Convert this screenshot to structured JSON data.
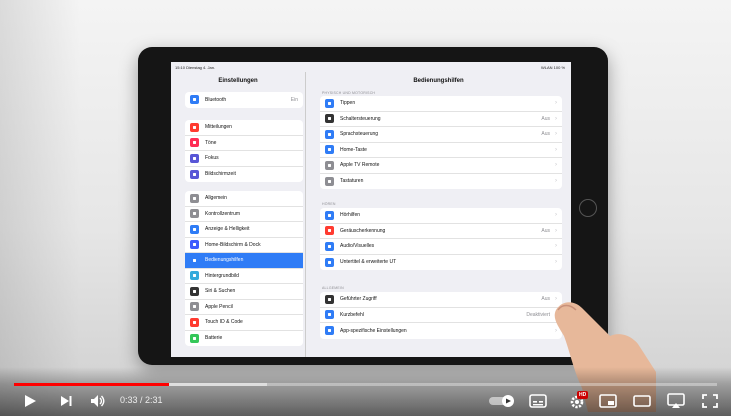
{
  "statusbar": {
    "time": "15:10  Dienstag 4. Jan.",
    "right": "WLAN 100 %"
  },
  "sidebar": {
    "title": "Einstellungen",
    "group1": [
      {
        "label": "Bluetooth",
        "value": "Ein",
        "icon": "bluetooth-icon",
        "color": "#2f7cf6"
      }
    ],
    "group2": [
      {
        "label": "Mitteilungen",
        "icon": "notifications-icon",
        "color": "#ff3b30"
      },
      {
        "label": "Töne",
        "icon": "sound-icon",
        "color": "#ff2d55"
      },
      {
        "label": "Fokus",
        "icon": "moon-icon",
        "color": "#5856d6"
      },
      {
        "label": "Bildschirmzeit",
        "icon": "hourglass-icon",
        "color": "#5856d6"
      }
    ],
    "group3": [
      {
        "label": "Allgemein",
        "icon": "gear-icon",
        "color": "#8e8e93"
      },
      {
        "label": "Kontrollzentrum",
        "icon": "control-center-icon",
        "color": "#8e8e93"
      },
      {
        "label": "Anzeige & Helligkeit",
        "icon": "display-icon",
        "color": "#2f7cf6"
      },
      {
        "label": "Home-Bildschirm & Dock",
        "icon": "home-screen-icon",
        "color": "#3d5afe"
      },
      {
        "label": "Bedienungshilfen",
        "icon": "accessibility-icon",
        "color": "#2f7cf6",
        "selected": true
      },
      {
        "label": "Hintergrundbild",
        "icon": "wallpaper-icon",
        "color": "#34aadc"
      },
      {
        "label": "Siri & Suchen",
        "icon": "siri-icon",
        "color": "#333333"
      },
      {
        "label": "Apple Pencil",
        "icon": "pencil-icon",
        "color": "#8e8e93"
      },
      {
        "label": "Touch ID & Code",
        "icon": "fingerprint-icon",
        "color": "#ff3b30"
      },
      {
        "label": "Batterie",
        "icon": "battery-icon",
        "color": "#34c759"
      }
    ]
  },
  "detail": {
    "title": "Bedienungshilfen",
    "sec1_header": "PHYSISCH UND MOTORISCH",
    "group1": [
      {
        "label": "Tippen",
        "icon": "hand-icon",
        "color": "#2f7cf6"
      },
      {
        "label": "Schaltersteuerung",
        "icon": "switch-icon",
        "color": "#333333",
        "value": "Aus"
      },
      {
        "label": "Sprachsteuerung",
        "icon": "voice-icon",
        "color": "#2f7cf6",
        "value": "Aus"
      },
      {
        "label": "Home-Taste",
        "icon": "home-button-icon",
        "color": "#2f7cf6"
      },
      {
        "label": "Apple TV Remote",
        "icon": "remote-icon",
        "color": "#8e8e93"
      },
      {
        "label": "Tastaturen",
        "icon": "keyboard-icon",
        "color": "#8e8e93"
      }
    ],
    "sec2_header": "HÖREN",
    "group2": [
      {
        "label": "Hörhilfen",
        "icon": "ear-icon",
        "color": "#2f7cf6"
      },
      {
        "label": "Geräuscherkennung",
        "icon": "waveform-icon",
        "color": "#ff3b30",
        "value": "Aus"
      },
      {
        "label": "Audio/Visuelles",
        "icon": "speaker-icon",
        "color": "#2f7cf6"
      },
      {
        "label": "Untertitel & erweiterte UT",
        "icon": "captions-icon",
        "color": "#2f7cf6"
      }
    ],
    "sec3_header": "ALLGEMEIN",
    "group3": [
      {
        "label": "Geführter Zugriff",
        "icon": "lock-icon",
        "color": "#333333",
        "value": "Aus"
      },
      {
        "label": "Kurzbefehl",
        "icon": "shortcut-icon",
        "color": "#2f7cf6",
        "value": "Deaktiviert"
      },
      {
        "label": "App-spezifische Einstellungen",
        "icon": "app-settings-icon",
        "color": "#2f7cf6"
      }
    ]
  },
  "player": {
    "time": "0:33 / 2:31",
    "progress": 0.22,
    "buffered": 0.36,
    "accent": "#ff0000",
    "hd_badge": "HD"
  }
}
